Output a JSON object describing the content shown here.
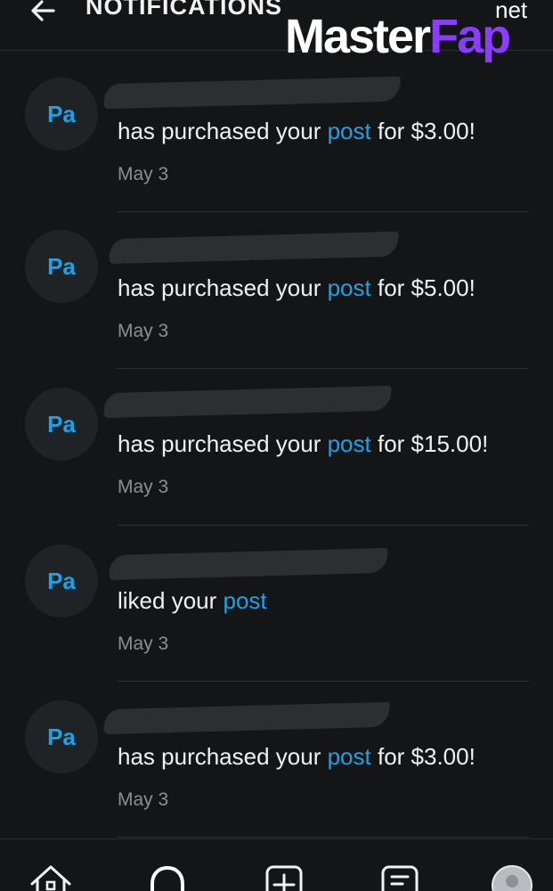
{
  "header": {
    "title": "NOTIFICATIONS",
    "back_icon": "arrow-left-icon"
  },
  "watermark": {
    "master": "Master",
    "fap": "Fap",
    "net": "net"
  },
  "notifications": [
    {
      "avatar": "Pa",
      "before": "has purchased your ",
      "link": "post",
      "after": " for $3.00!",
      "date": "May 3"
    },
    {
      "avatar": "Pa",
      "before": "has purchased your ",
      "link": "post",
      "after": " for $5.00!",
      "date": "May 3"
    },
    {
      "avatar": "Pa",
      "before": "has purchased your ",
      "link": "post",
      "after": " for $15.00!",
      "date": "May 3"
    },
    {
      "avatar": "Pa",
      "before": "liked your ",
      "link": "post",
      "after": "",
      "date": "May 3"
    },
    {
      "avatar": "Pa",
      "before": "has purchased your ",
      "link": "post",
      "after": " for $3.00!",
      "date": "May 3"
    }
  ],
  "bottom_nav": {
    "items": [
      "home-icon",
      "notifications-bell-icon",
      "add-post-icon",
      "messages-icon",
      "profile-avatar"
    ]
  },
  "colors": {
    "background": "#141517",
    "accent": "#1ea1e6",
    "muted_text": "#8b8e93",
    "avatar_bg": "#202326",
    "watermark_fap": "#8a3cff"
  }
}
